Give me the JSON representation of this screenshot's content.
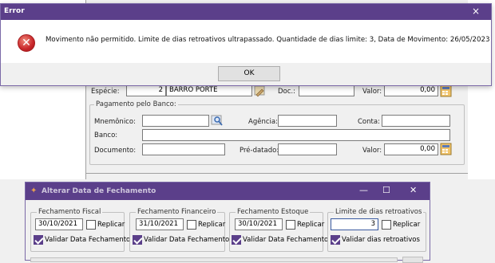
{
  "error_dialog": {
    "title": "Error",
    "close_glyph": "×",
    "message": "Movimento não permitido. Limite de dias retroativos ultrapassado. Quantidade de dias limite: 3, Data de Movimento: 26/05/2023",
    "ok_label": "OK",
    "icon": "error-x-icon",
    "accent": "#5b3f8a"
  },
  "form": {
    "especie_label": "Espécie:",
    "especie_code": "2",
    "especie_name": "BARRO PORTE",
    "doc_label": "Doc.:",
    "valor_label_top": "Valor:",
    "valor_top": "0,00",
    "pagamento_legend": "Pagamento pelo Banco:",
    "mnemonico_label": "Mnemônico:",
    "agencia_label": "Agência:",
    "conta_label": "Conta:",
    "banco_label": "Banco:",
    "documento_label": "Documento:",
    "predatado_label": "Pré-datado:",
    "valor_label": "Valor:",
    "valor": "0,00"
  },
  "dialog": {
    "title": "Alterar Data de Fechamento",
    "min_glyph": "—",
    "max_glyph": "☐",
    "close_glyph": "✕",
    "groups": [
      {
        "legend": "Fechamento Fiscal",
        "date": "30/10/2021",
        "replicar": "Replicar",
        "validar": "Validar Data Fechamento"
      },
      {
        "legend": "Fechamento Financeiro",
        "date": "31/10/2021",
        "replicar": "Replicar",
        "validar": "Validar Data Fechamento"
      },
      {
        "legend": "Fechamento Estoque",
        "date": "30/10/2021",
        "replicar": "Replicar",
        "validar": "Validar Data Fechamento"
      },
      {
        "legend": "Limite de dias retroativos",
        "date": "3",
        "replicar": "Replicar",
        "validar": "Validar dias retroativos"
      }
    ]
  }
}
